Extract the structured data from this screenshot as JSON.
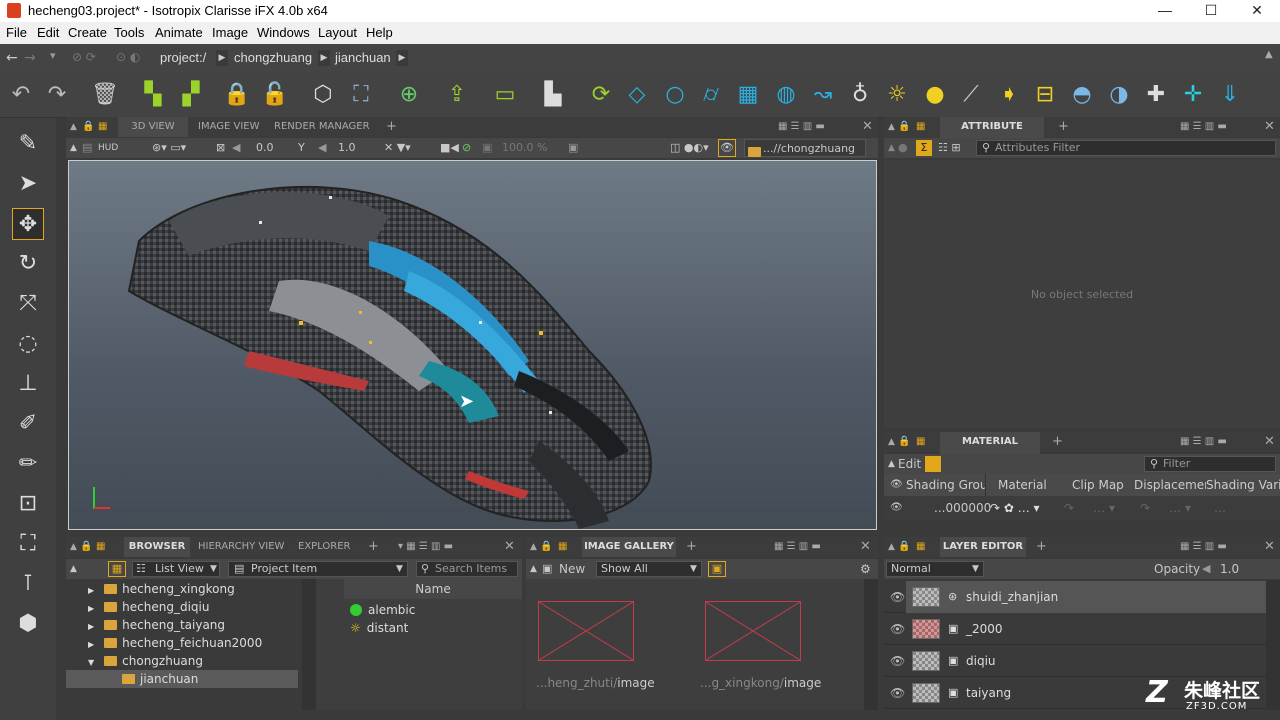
{
  "window": {
    "title": "hecheng03.project* - Isotropix Clarisse iFX 4.0b x64",
    "minimize": "—",
    "maximize": "☐",
    "close": "✕"
  },
  "menu": [
    "File",
    "Edit",
    "Create",
    "Tools",
    "Animate",
    "Image",
    "Windows",
    "Layout",
    "Help"
  ],
  "breadcrumb": [
    "project:/",
    "chongzhuang",
    "jianchuan"
  ],
  "viewport_panel": {
    "tabs": [
      "3D VIEW",
      "IMAGE VIEW",
      "RENDER MANAGER"
    ],
    "add": "+",
    "hud": "HUD",
    "value1": "0.0",
    "value2": "1.0",
    "zoom": "100.0 %",
    "path": "...//chongzhuang"
  },
  "attribute_editor": {
    "title": "ATTRIBUTE EDITOR",
    "filter_placeholder": "Attributes Filter",
    "empty": "No object selected"
  },
  "material_linker": {
    "title": "MATERIAL LINKER",
    "edit": "Edit",
    "filter_placeholder": "Filter",
    "columns": [
      "Shading Group",
      "Material",
      "Clip Map",
      "Displacement",
      "Shading Variab"
    ],
    "row_value": "...000000"
  },
  "browser": {
    "tabs": [
      "BROWSER",
      "HIERARCHY VIEW",
      "EXPLORER"
    ],
    "view_mode": "List View",
    "item_type": "Project Item",
    "search_placeholder": "Search Items",
    "column": "Name",
    "tree": [
      {
        "label": "hecheng_xingkong",
        "open": false
      },
      {
        "label": "hecheng_diqiu",
        "open": false
      },
      {
        "label": "hecheng_taiyang",
        "open": false
      },
      {
        "label": "hecheng_feichuan2000",
        "open": false
      },
      {
        "label": "chongzhuang",
        "open": true
      },
      {
        "label": "jianchuan",
        "child": true
      }
    ],
    "items": [
      "alembic",
      "distant"
    ]
  },
  "image_gallery": {
    "title": "IMAGE GALLERY",
    "new": "New",
    "filter": "Show All",
    "images": [
      {
        "prefix": "...heng_zhuti/",
        "name": "image"
      },
      {
        "prefix": "...g_xingkong/",
        "name": "image"
      }
    ]
  },
  "layer_editor": {
    "title": "LAYER EDITOR",
    "blend": "Normal",
    "opacity_label": "Opacity",
    "opacity": "1.0",
    "layers": [
      "shuidi_zhanjian",
      "_2000",
      "diqiu",
      "taiyang"
    ]
  },
  "watermark": {
    "text": "朱峰社区",
    "url": "ZF3D.COM"
  },
  "colors": {
    "accent": "#e0a81a",
    "selection": "#6a6a6a",
    "viewport_border": "#cccccc"
  }
}
